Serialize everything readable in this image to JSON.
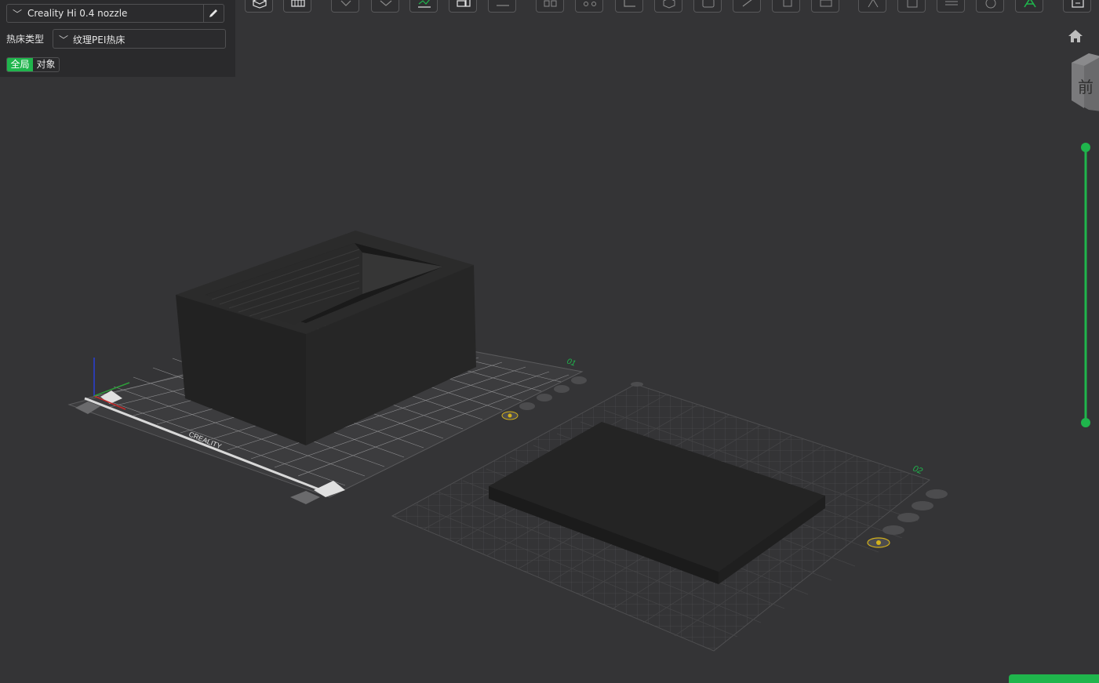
{
  "printer": {
    "selected": "Creality Hi 0.4 nozzle",
    "dropdown_icon": "chevron-down-icon",
    "edit_icon": "pencil-icon"
  },
  "bed_type": {
    "label": "热床类型",
    "selected": "纹理PEI热床",
    "dropdown_icon": "chevron-down-icon"
  },
  "scope": {
    "global_label": "全局",
    "object_label": "对象",
    "active": "global"
  },
  "toolbar": {
    "tools": [
      "add-object-icon",
      "arrange-grid-icon",
      "orient-icon",
      "lay-flat-icon",
      "auto-orient-icon",
      "split-to-objects-icon",
      "split-to-parts-icon",
      "multi-plate-icon",
      "assembly-icon",
      "measure-icon",
      "cube-view-icon",
      "support-paint-icon",
      "seam-paint-icon",
      "color-paint-icon",
      "cut-icon",
      "scale-icon",
      "hollow-icon",
      "boolean-icon",
      "text-icon",
      "emboss-icon",
      "slice-view-icon",
      "return-icon"
    ]
  },
  "view_cube": {
    "front_face_label": "前"
  },
  "plates": [
    {
      "label": "01"
    },
    {
      "label": "02"
    }
  ],
  "bed_brand": "CREALITY",
  "colors": {
    "accent": "#1fb54c",
    "background": "#343436",
    "panel": "#2a2a2c",
    "model": "#242424",
    "plate_label": "#1fb54c",
    "lock_icon": "#d4b21a"
  }
}
